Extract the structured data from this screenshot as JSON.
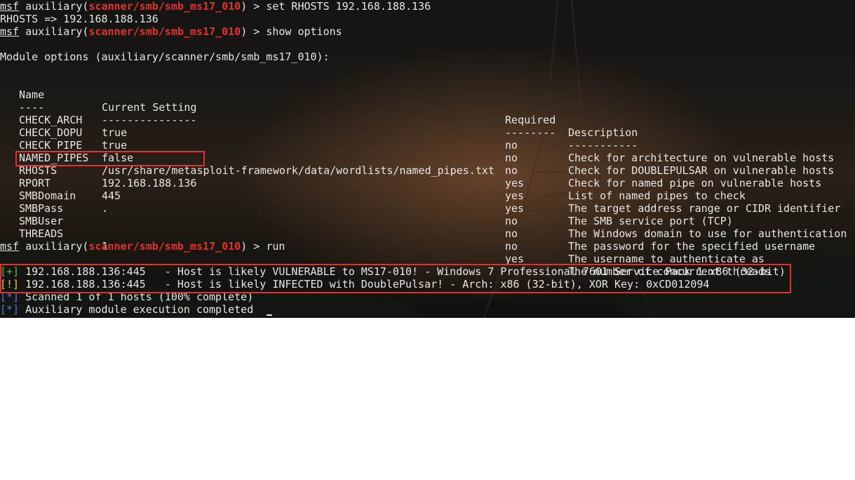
{
  "terminal": {
    "line1": {
      "prompt": "msf",
      "prefix": " auxiliary(",
      "module": "scanner/smb/smb_ms17_010",
      "suffix": ") > ",
      "cmd": "set RHOSTS 192.168.188.136"
    },
    "line2": "RHOSTS => 192.168.188.136",
    "line3": {
      "prompt": "msf",
      "prefix": " auxiliary(",
      "module": "scanner/smb/smb_ms17_010",
      "suffix": ") > ",
      "cmd": "show options"
    },
    "module_options_header": "Module options (auxiliary/scanner/smb/smb_ms17_010):",
    "columns": {
      "name": "Name",
      "setting": "Current Setting",
      "required": "Required",
      "description": "Description",
      "name_ul": "----",
      "setting_ul": "---------------",
      "required_ul": "--------",
      "description_ul": "-----------"
    },
    "options": [
      {
        "name": "CHECK_ARCH",
        "setting": "true",
        "required": "no",
        "description": "Check for architecture on vulnerable hosts"
      },
      {
        "name": "CHECK_DOPU",
        "setting": "true",
        "required": "no",
        "description": "Check for DOUBLEPULSAR on vulnerable hosts"
      },
      {
        "name": "CHECK_PIPE",
        "setting": "false",
        "required": "no",
        "description": "Check for named pipe on vulnerable hosts"
      },
      {
        "name": "NAMED_PIPES",
        "setting": "/usr/share/metasploit-framework/data/wordlists/named_pipes.txt",
        "required": "yes",
        "description": "List of named pipes to check"
      },
      {
        "name": "RHOSTS",
        "setting": "192.168.188.136",
        "required": "yes",
        "description": "The target address range or CIDR identifier"
      },
      {
        "name": "RPORT",
        "setting": "445",
        "required": "yes",
        "description": "The SMB service port (TCP)"
      },
      {
        "name": "SMBDomain",
        "setting": ".",
        "required": "no",
        "description": "The Windows domain to use for authentication"
      },
      {
        "name": "SMBPass",
        "setting": "",
        "required": "no",
        "description": "The password for the specified username"
      },
      {
        "name": "SMBUser",
        "setting": "",
        "required": "no",
        "description": "The username to authenticate as"
      },
      {
        "name": "THREADS",
        "setting": "1",
        "required": "yes",
        "description": "The number of concurrent threads"
      }
    ],
    "line_run": {
      "prompt": "msf",
      "prefix": " auxiliary(",
      "module": "scanner/smb/smb_ms17_010",
      "suffix": ") > ",
      "cmd": "run"
    },
    "results": [
      {
        "tag": "[+]",
        "text": " 192.168.188.136:445   - Host is likely VULNERABLE to MS17-010! - Windows 7 Professional 7601 Service Pack 1 x86 (32-bit)"
      },
      {
        "tag": "[!]",
        "text": " 192.168.188.136:445   - Host is likely INFECTED with DoublePulsar! - Arch: x86 (32-bit), XOR Key: 0xCD012094"
      },
      {
        "tag": "[*]",
        "text": " Scanned 1 of 1 hosts (100% complete)"
      },
      {
        "tag": "[*]",
        "text": " Auxiliary module execution completed"
      }
    ]
  },
  "colors": {
    "module_red": "#e0332d",
    "success_green": "#2fcf3a",
    "warning_yellow": "#e7d236",
    "info_blue": "#4f78e8",
    "highlight_box": "#e0332d"
  }
}
